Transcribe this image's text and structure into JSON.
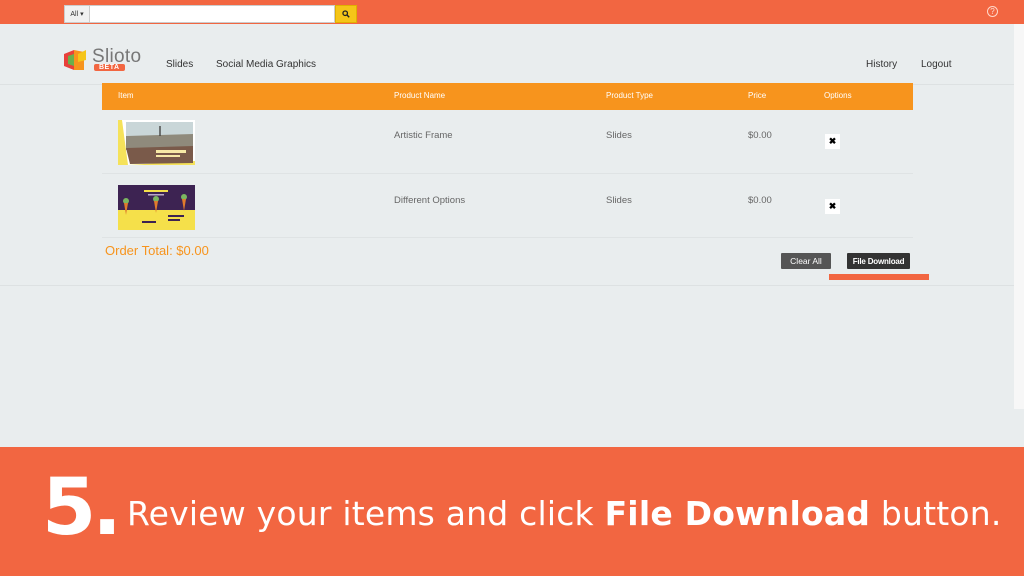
{
  "topbar": {
    "search_scope": "All",
    "search_placeholder": ""
  },
  "navbar": {
    "logo_text": "Slioto",
    "logo_badge": "BETA",
    "links": [
      "Slides",
      "Social Media Graphics"
    ],
    "right_links": [
      "History",
      "Logout"
    ]
  },
  "table": {
    "headers": [
      "Item",
      "Product Name",
      "Product Type",
      "Price",
      "Options"
    ],
    "rows": [
      {
        "name": "Artistic Frame",
        "type": "Slides",
        "price": "$0.00"
      },
      {
        "name": "Different Options",
        "type": "Slides",
        "price": "$0.00"
      }
    ]
  },
  "order_total": "Order Total: $0.00",
  "buttons": {
    "clear_all": "Clear All",
    "file_download": "File Download"
  },
  "banner": {
    "step": "5.",
    "text_before": "Review your items and click ",
    "text_bold": "File Download",
    "text_after": " button."
  },
  "colors": {
    "brand_orange": "#f26641",
    "table_header": "#f7941d"
  }
}
